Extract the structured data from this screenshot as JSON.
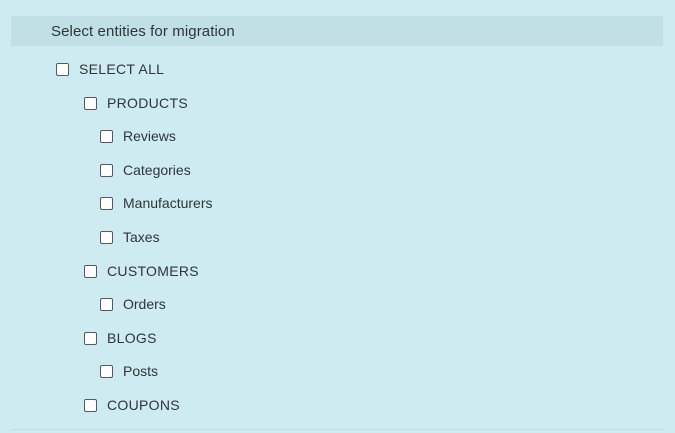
{
  "header": {
    "title": "Select entities for migration"
  },
  "select_all": {
    "label": "SELECT ALL",
    "checked": false
  },
  "groups": {
    "products": {
      "label": "PRODUCTS",
      "children": [
        "Reviews",
        "Categories",
        "Manufacturers",
        "Taxes"
      ]
    },
    "customers": {
      "label": "CUSTOMERS",
      "children": [
        "Orders"
      ]
    },
    "blogs": {
      "label": "BLOGS",
      "children": [
        "Posts"
      ]
    },
    "coupons": {
      "label": "COUPONS",
      "children": []
    }
  },
  "colors": {
    "background": "#cdebf1",
    "header_band": "#c0e0e5",
    "text": "#2f3538"
  }
}
